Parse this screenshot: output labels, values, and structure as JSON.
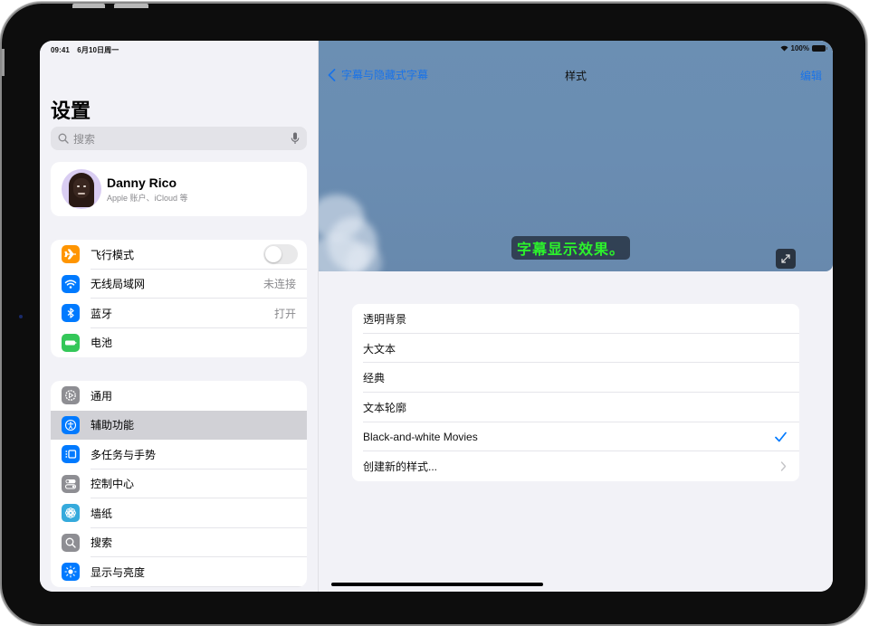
{
  "status_bar": {
    "time": "09:41",
    "date": "6月10日周一",
    "battery": "100%"
  },
  "sidebar": {
    "title": "设置",
    "search": {
      "placeholder": "搜索"
    },
    "profile": {
      "name": "Danny Rico",
      "subtitle": "Apple 账户、iCloud 等"
    },
    "group1": [
      {
        "label": "飞行模式",
        "icon": "airplane-icon",
        "color": "#ff9500",
        "control": "toggle",
        "toggle_on": false
      },
      {
        "label": "无线局域网",
        "icon": "wifi-icon",
        "color": "#007aff",
        "value": "未连接"
      },
      {
        "label": "蓝牙",
        "icon": "bluetooth-icon",
        "color": "#007aff",
        "value": "打开"
      },
      {
        "label": "电池",
        "icon": "battery-icon",
        "color": "#34c759"
      }
    ],
    "group2": [
      {
        "label": "通用",
        "icon": "gear-icon",
        "color": "#8e8e93"
      },
      {
        "label": "辅助功能",
        "icon": "accessibility-icon",
        "color": "#007aff",
        "selected": true
      },
      {
        "label": "多任务与手势",
        "icon": "multitasking-icon",
        "color": "#007aff"
      },
      {
        "label": "控制中心",
        "icon": "control-center-icon",
        "color": "#8e8e93"
      },
      {
        "label": "墙纸",
        "icon": "wallpaper-icon",
        "color": "#35aadc"
      },
      {
        "label": "搜索",
        "icon": "search-icon",
        "color": "#8e8e93"
      },
      {
        "label": "显示与亮度",
        "icon": "brightness-icon",
        "color": "#007aff"
      }
    ]
  },
  "detail": {
    "nav": {
      "back_label": "字幕与隐藏式字幕",
      "title": "样式",
      "edit_label": "编辑"
    },
    "preview": {
      "caption_text": "字幕显示效果。",
      "caption_color": "#2cf22c"
    },
    "styles": [
      {
        "label": "透明背景"
      },
      {
        "label": "大文本"
      },
      {
        "label": "经典"
      },
      {
        "label": "文本轮廓"
      },
      {
        "label": "Black-and-white Movies",
        "selected": true
      },
      {
        "label": "创建新的样式...",
        "disclosure": true
      }
    ]
  },
  "colors": {
    "accent": "#007aff",
    "selected_row": "#d1d1d6"
  }
}
